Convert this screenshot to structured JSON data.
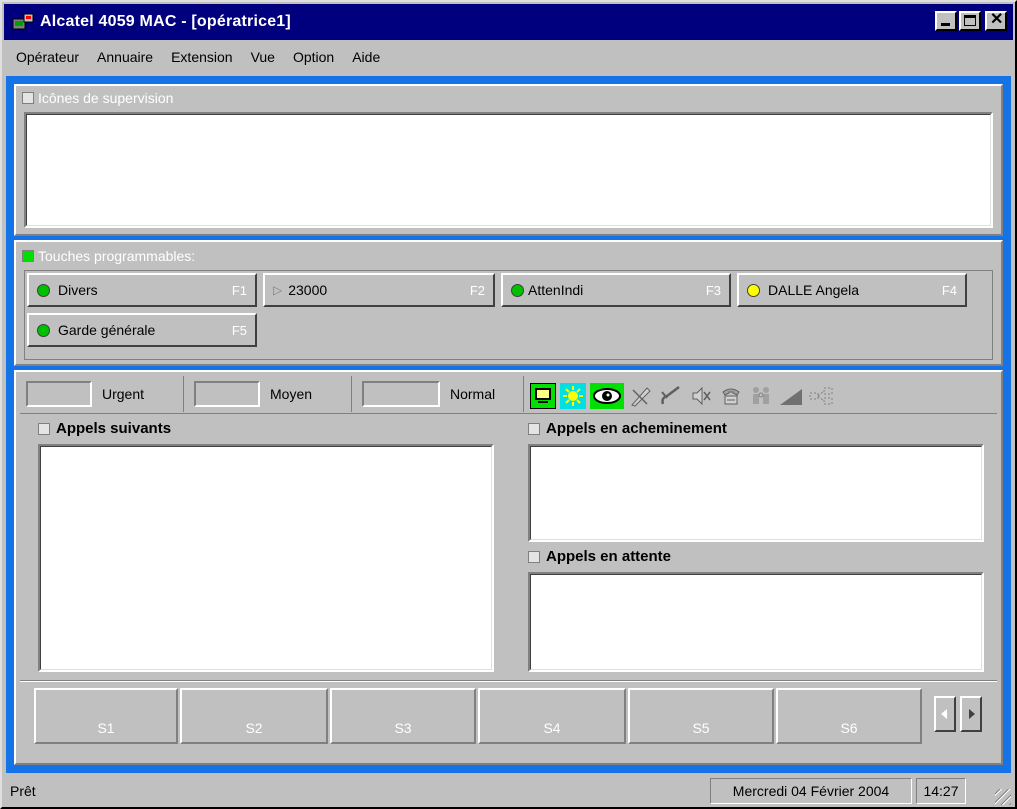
{
  "window": {
    "title": "Alcatel 4059 MAC - [opératrice1]"
  },
  "menu": [
    "Opérateur",
    "Annuaire",
    "Extension",
    "Vue",
    "Option",
    "Aide"
  ],
  "supervision": {
    "label": "Icônes de supervision"
  },
  "function_keys": {
    "label": "Touches programmables:",
    "keys": [
      {
        "label": "Divers",
        "key": "F1",
        "led": "#00c000",
        "icon": "green-led-icon"
      },
      {
        "label": "23000",
        "key": "F2",
        "led": "",
        "icon": "play-triangle-icon"
      },
      {
        "label": "AttenIndi",
        "key": "F3",
        "led": "#00c000",
        "icon": "green-led-icon"
      },
      {
        "label": "DALLE Angela",
        "key": "F4",
        "led": "#ffff00",
        "icon": "yellow-led-icon"
      },
      {
        "label": "Garde générale",
        "key": "F5",
        "led": "#00c000",
        "icon": "green-led-icon"
      }
    ]
  },
  "priorities": [
    {
      "label": "Urgent"
    },
    {
      "label": "Moyen"
    },
    {
      "label": "Normal"
    }
  ],
  "toolbar_icons": [
    "monitor-icon",
    "sun-icon",
    "eye-icon",
    "pen-cross-icon",
    "handset-check-icon",
    "speaker-mute-icon",
    "phone-transfer-icon",
    "people-icon",
    "signal-icon",
    "network-icon"
  ],
  "sections": {
    "next_calls": "Appels suivants",
    "routing_calls": "Appels en acheminement",
    "waiting_calls": "Appels en attente"
  },
  "softkeys": [
    "S1",
    "S2",
    "S3",
    "S4",
    "S5",
    "S6"
  ],
  "status": {
    "text": "Prêt",
    "date": "Mercredi 04 Février 2004",
    "time": "14:27"
  },
  "colors": {
    "frame_blue": "#1473e7",
    "title_blue": "#00007e",
    "led_green": "#00c000",
    "led_yellow": "#ffff00"
  }
}
